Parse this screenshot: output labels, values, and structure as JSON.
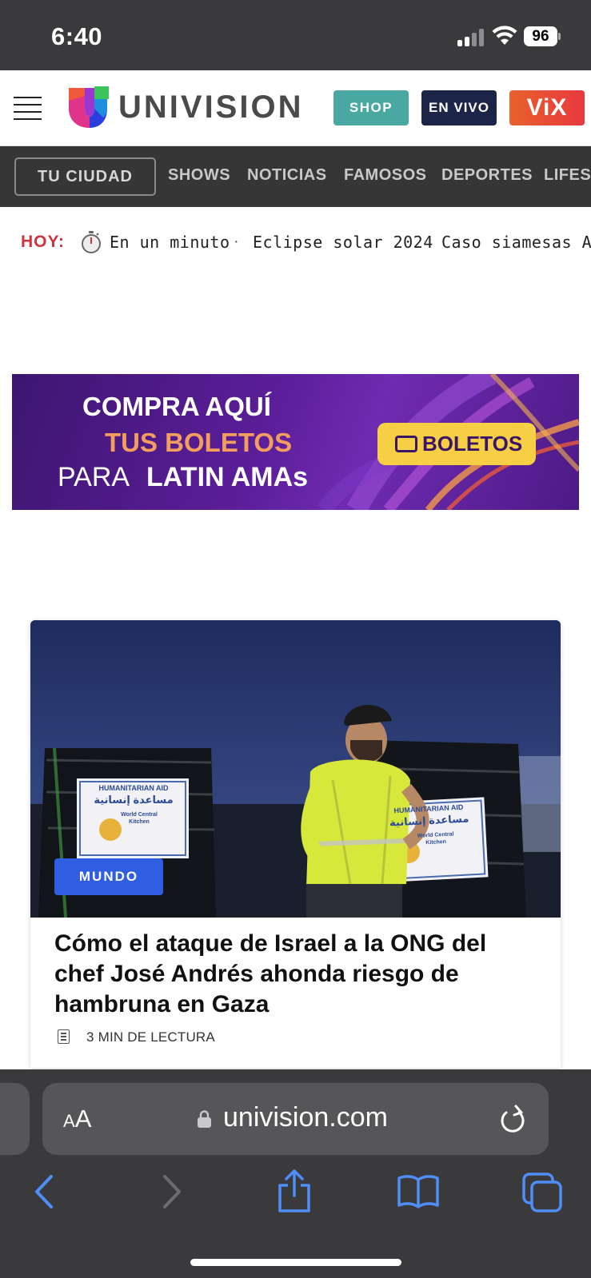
{
  "status_bar": {
    "time": "6:40",
    "battery": "96"
  },
  "header": {
    "logo_text": "UNIVISION",
    "shop_label": "SHOP",
    "live_label": "EN VIVO",
    "vix_label": "ViX"
  },
  "nav": {
    "city_label": "TU CIUDAD",
    "items": [
      "SHOWS",
      "NOTICIAS",
      "FAMOSOS",
      "DEPORTES",
      "LIFEST"
    ]
  },
  "ticker": {
    "label": "HOY:",
    "items": [
      "En un minuto",
      "Eclipse solar 2024",
      "Caso siamesas Al"
    ],
    "separator": "·"
  },
  "ad": {
    "line1": "COMPRA AQUÍ",
    "line2": "TUS BOLETOS",
    "line3_prefix": "PARA",
    "line3_bold": "LATIN AMAs",
    "button_label": "BOLETOS"
  },
  "article": {
    "category": "MUNDO",
    "headline": "Cómo el ataque de Israel a la ONG del chef José Andrés ahonda riesgo de hambruna en Gaza",
    "read_time": "3 MIN DE LECTURA",
    "photo_sign_line1": "HUMANITARIAN AID",
    "photo_sign_arabic": "مساعدة إنسانية",
    "photo_sign_org": "World Central Kitchen"
  },
  "browser": {
    "text_size_label": "AA",
    "url": "univision.com"
  },
  "colors": {
    "hoy_red": "#d0333c",
    "shop_teal": "#4aa8a3",
    "live_navy": "#1c2447",
    "category_blue": "#2f5fe0",
    "ios_blue": "#4e8ef7"
  }
}
